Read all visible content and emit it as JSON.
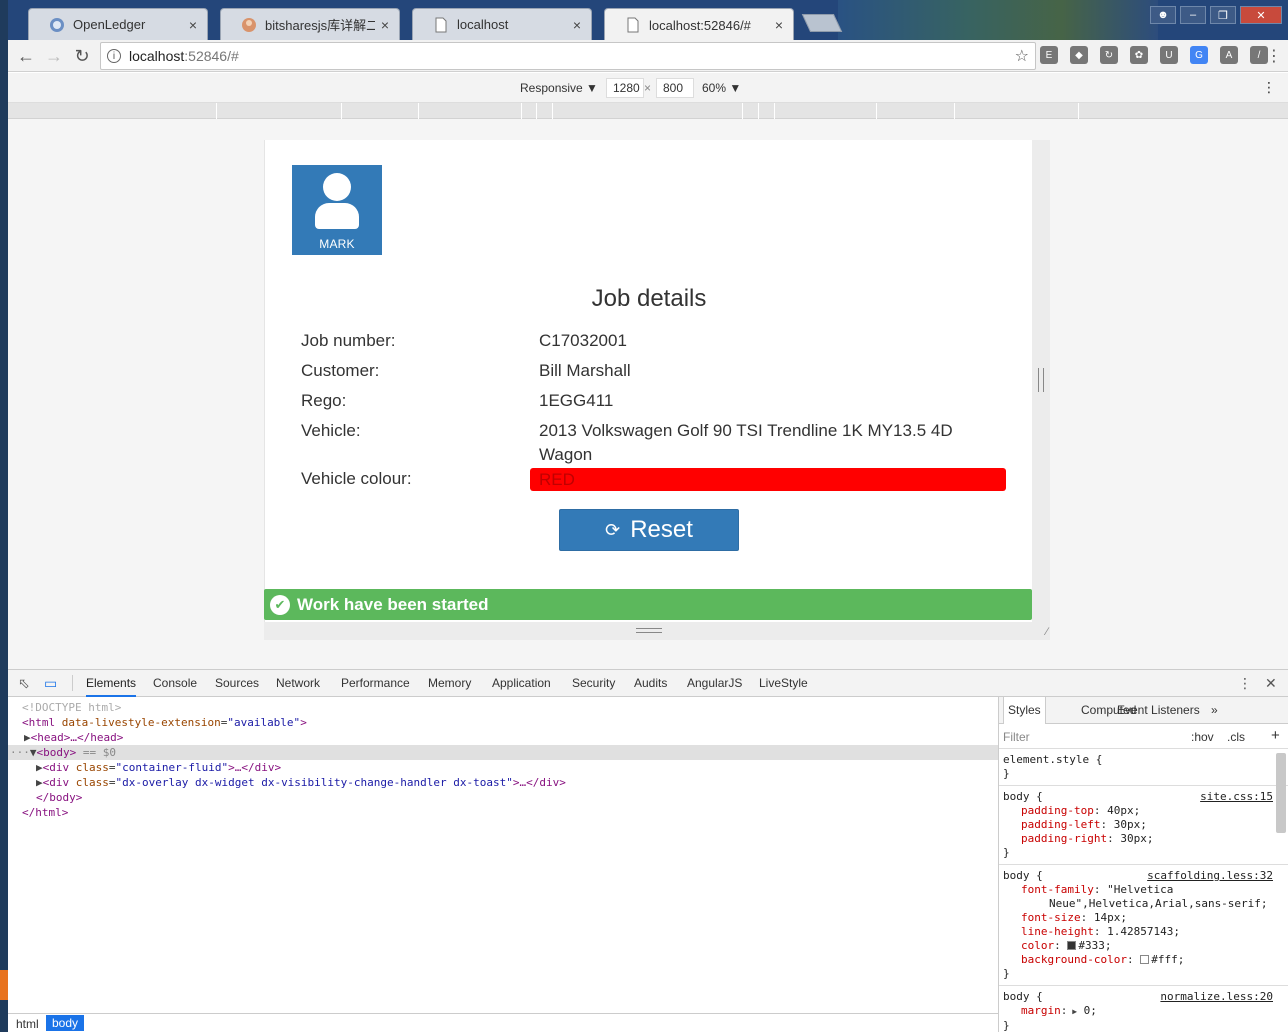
{
  "browser": {
    "tabs": [
      {
        "label": "OpenLedger",
        "active": false
      },
      {
        "label": "bitsharesjs库详解二：交",
        "active": false
      },
      {
        "label": "localhost",
        "active": false
      },
      {
        "label": "localhost:52846/#",
        "active": true
      }
    ],
    "close_glyph": "×",
    "url_host": "localhost",
    "url_path": ":52846/#"
  },
  "device_toolbar": {
    "mode": "Responsive",
    "width": "1280",
    "times": "×",
    "height": "800",
    "zoom": "60%"
  },
  "app": {
    "user_name": "MARK",
    "title": "Job details",
    "fields": [
      {
        "label": "Job number:",
        "value": "C17032001"
      },
      {
        "label": "Customer:",
        "value": "Bill Marshall"
      },
      {
        "label": "Rego:",
        "value": "1EGG411"
      },
      {
        "label": "Vehicle:",
        "value": "2013 Volkswagen Golf 90 TSI Trendline 1K MY13.5 4D Wagon"
      }
    ],
    "colour_label": "Vehicle colour:",
    "colour_value": "RED",
    "colour_swatch": "#ff0000",
    "reset_label": "Reset",
    "toast_message": "Work have been started",
    "toast_color": "#5cb85c"
  },
  "devtools": {
    "tabs": [
      "Elements",
      "Console",
      "Sources",
      "Network",
      "Performance",
      "Memory",
      "Application",
      "Security",
      "Audits",
      "AngularJS",
      "LiveStyle"
    ],
    "active_tab": "Elements",
    "dom": {
      "doctype": "<!DOCTYPE html>",
      "html_open_tag": "<html",
      "html_attr": "data-livestyle-extension",
      "html_attr_val": "\"available\"",
      "head": "<head>…</head>",
      "body_open": "<body>",
      "body_marker": " == $0",
      "div1_tag": "<div",
      "div1_attr": "class",
      "div1_val": "\"container-fluid\"",
      "div1_rest": ">…</div>",
      "div2_tag": "<div",
      "div2_attr": "class",
      "div2_val": "\"dx-overlay dx-widget dx-visibility-change-handler dx-toast\"",
      "div2_rest": ">…</div>",
      "body_close": "</body>",
      "html_close": "</html>"
    },
    "breadcrumb": [
      "html",
      "body"
    ],
    "styles_tabs": [
      "Styles",
      "Computed",
      "Event Listeners"
    ],
    "filter_placeholder": "Filter",
    "hov": ":hov",
    "cls": ".cls",
    "rules": [
      {
        "selector": "element.style {",
        "source": "",
        "decls": [],
        "close": "}"
      },
      {
        "selector": "body {",
        "source": "site.css:15",
        "decls": [
          {
            "prop": "padding-top",
            "val": "40px;"
          },
          {
            "prop": "padding-left",
            "val": "30px;"
          },
          {
            "prop": "padding-right",
            "val": "30px;"
          }
        ],
        "close": "}"
      },
      {
        "selector": "body {",
        "source": "scaffolding.less:32",
        "decls": [
          {
            "prop": "font-family",
            "val": "\"Helvetica"
          },
          {
            "prop": "",
            "val": "Neue\",Helvetica,Arial,sans-serif;"
          },
          {
            "prop": "font-size",
            "val": "14px;"
          },
          {
            "prop": "line-height",
            "val": "1.42857143;"
          },
          {
            "prop": "color",
            "val": "#333;"
          },
          {
            "prop": "background-color",
            "val": "#fff;"
          }
        ],
        "close": "}"
      },
      {
        "selector": "body {",
        "source": "normalize.less:20",
        "decls": [
          {
            "prop": "margin",
            "val": "0;"
          }
        ],
        "close": "}"
      }
    ]
  }
}
